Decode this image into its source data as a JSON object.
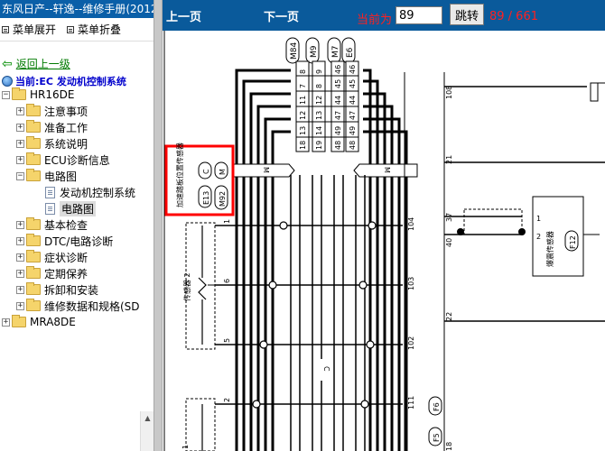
{
  "app": {
    "title": "东风日产--轩逸--维修手册(2012)"
  },
  "toolbar": {
    "expand_label": "菜单展开",
    "collapse_label": "菜单折叠"
  },
  "back_link": "返回上一级",
  "current": "当前:EC 发动机控制系统",
  "tree": [
    {
      "label": "HR16DE"
    },
    {
      "label": "注意事项"
    },
    {
      "label": "准备工作"
    },
    {
      "label": "系统说明"
    },
    {
      "label": "ECU诊断信息"
    },
    {
      "label": "电路图"
    },
    {
      "label": "发动机控制系统"
    },
    {
      "label": "电路图"
    },
    {
      "label": "基本检查"
    },
    {
      "label": "DTC/电路诊断"
    },
    {
      "label": "症状诊断"
    },
    {
      "label": "定期保养"
    },
    {
      "label": "拆卸和安装"
    },
    {
      "label": "维修数据和规格(SD"
    },
    {
      "label": "MRA8DE"
    }
  ],
  "nav": {
    "prev_label": "上一页",
    "next_label": "下一页",
    "current_label": "当前为",
    "page_value": "89",
    "jump_label": "跳转",
    "pages": "89 / 661"
  },
  "diagram": {
    "connectors": [
      "M84",
      "M9",
      "M7",
      "E6"
    ],
    "pins_col1": [
      "8",
      "7",
      "11",
      "12",
      "13",
      "18"
    ],
    "pins_col2": [
      "9",
      "8",
      "12",
      "13",
      "14",
      "19"
    ],
    "pins_col3": [
      "46",
      "45",
      "44",
      "47",
      "49",
      "48"
    ],
    "pins_col4": [
      "46",
      "45",
      "44",
      "47",
      "49",
      "48"
    ],
    "m_label": "M",
    "c_label": "C",
    "sensor_name": "加速踏板位置传感器",
    "sensor_ids": [
      "E13",
      "M92"
    ],
    "sensor2": "传感器 2",
    "sensor_pins": [
      "1",
      "6",
      "5",
      "2",
      "1"
    ],
    "wire_nums": [
      "104",
      "103",
      "102",
      "111"
    ],
    "wire_nums_right": [
      "108",
      "21",
      "37",
      "40",
      "22",
      "18"
    ],
    "f_labels": [
      "F6",
      "F5"
    ],
    "pump_sensor": "爆震传感器",
    "pump_id": "F12",
    "pump_pins": [
      "1",
      "2"
    ]
  }
}
